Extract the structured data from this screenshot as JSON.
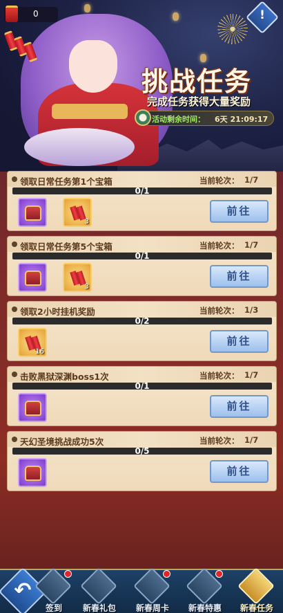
{
  "header": {
    "counter_value": "0",
    "title": "挑战任务",
    "subtitle": "完成任务获得大量奖励",
    "timer_label": "活动剩余时间：",
    "timer_value": "6天 21:09:17"
  },
  "info_label": "!",
  "task_round_label": "当前轮次：",
  "go_label": "前往",
  "tasks": [
    {
      "name": "领取日常任务第1个宝箱",
      "round": "1/7",
      "progress": "0/1",
      "items": [
        {
          "type": "chest",
          "rarity": "purple",
          "qty": ""
        },
        {
          "type": "firecracker",
          "rarity": "gold",
          "qty": "3"
        }
      ]
    },
    {
      "name": "领取日常任务第5个宝箱",
      "round": "1/7",
      "progress": "0/1",
      "items": [
        {
          "type": "chest",
          "rarity": "purple",
          "qty": ""
        },
        {
          "type": "firecracker",
          "rarity": "gold",
          "qty": "3"
        }
      ]
    },
    {
      "name": "领取2小时挂机奖励",
      "round": "1/3",
      "progress": "0/2",
      "items": [
        {
          "type": "firecracker",
          "rarity": "gold",
          "qty": "16"
        }
      ]
    },
    {
      "name": "击败黑狱深渊boss1次",
      "round": "1/7",
      "progress": "0/1",
      "items": [
        {
          "type": "chest",
          "rarity": "purple",
          "qty": ""
        }
      ]
    },
    {
      "name": "天幻圣境挑战成功5次",
      "round": "1/7",
      "progress": "0/5",
      "items": [
        {
          "type": "chest",
          "rarity": "purple",
          "qty": ""
        }
      ]
    }
  ],
  "nav": [
    {
      "label": "签到",
      "icon": "calendar-icon",
      "badge": true
    },
    {
      "label": "新春礼包",
      "icon": "gift-bag-icon",
      "badge": false
    },
    {
      "label": "新春周卡",
      "icon": "card-icon",
      "badge": true
    },
    {
      "label": "新春特惠",
      "icon": "chest-icon",
      "badge": true
    },
    {
      "label": "新春任务",
      "icon": "scroll-icon",
      "badge": false,
      "active": true
    }
  ],
  "colors": {
    "accent_gold": "#e7b75a",
    "button_blue": "#9dc0ec",
    "panel": "#f6e6cd"
  }
}
